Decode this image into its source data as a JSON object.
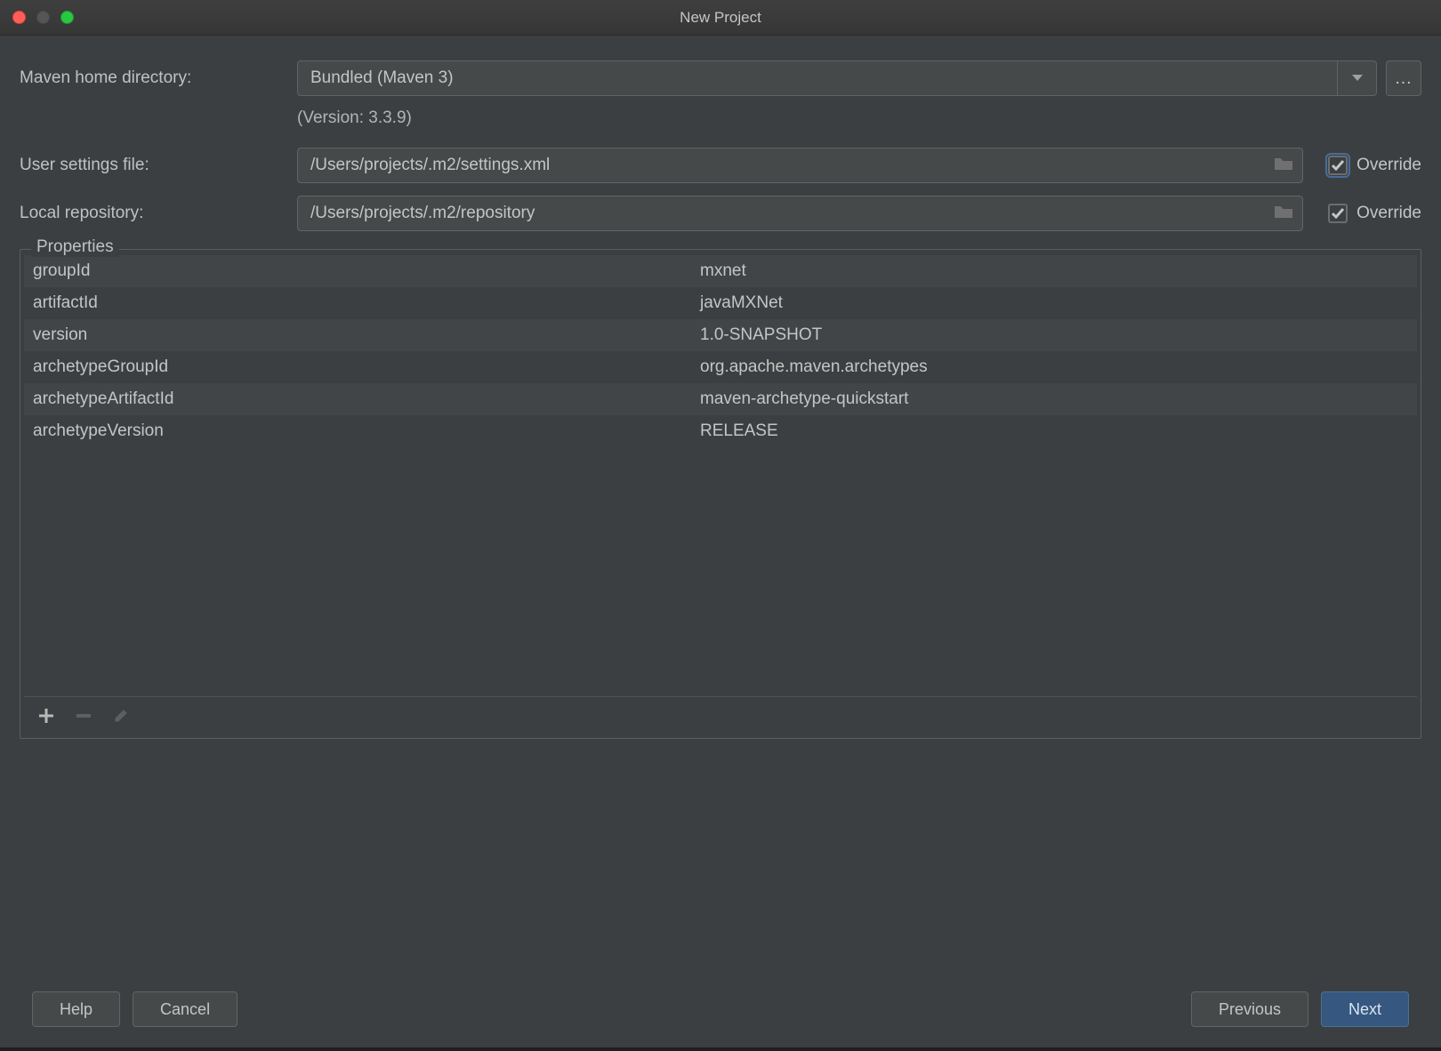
{
  "window": {
    "title": "New Project"
  },
  "labels": {
    "maven_home": "Maven home directory:",
    "user_settings": "User settings file:",
    "local_repo": "Local repository:",
    "override": "Override",
    "properties": "Properties"
  },
  "field": {
    "maven_home_value": "Bundled (Maven 3)",
    "version_text": "(Version: 3.3.9)",
    "user_settings_value": "/Users/projects/.m2/settings.xml",
    "local_repo_value": "/Users/projects/.m2/repository",
    "ellipsis": "…"
  },
  "checkboxes": {
    "override_user_settings": true,
    "override_local_repo": true
  },
  "properties": [
    {
      "key": "groupId",
      "value": "mxnet"
    },
    {
      "key": "artifactId",
      "value": "javaMXNet"
    },
    {
      "key": "version",
      "value": "1.0-SNAPSHOT"
    },
    {
      "key": "archetypeGroupId",
      "value": "org.apache.maven.archetypes"
    },
    {
      "key": "archetypeArtifactId",
      "value": "maven-archetype-quickstart"
    },
    {
      "key": "archetypeVersion",
      "value": "RELEASE"
    }
  ],
  "buttons": {
    "help": "Help",
    "cancel": "Cancel",
    "previous": "Previous",
    "next": "Next"
  }
}
